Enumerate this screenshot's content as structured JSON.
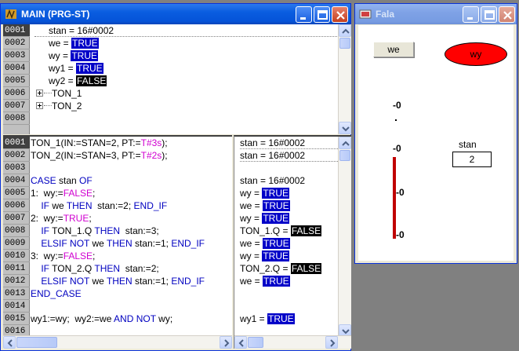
{
  "main_window": {
    "title": "MAIN (PRG-ST)",
    "declaration": {
      "line_numbers": [
        "0001",
        "0002",
        "0003",
        "0004",
        "0005",
        "0006",
        "0007",
        "0008"
      ],
      "lines": [
        {
          "name": "stan = 16#0002",
          "eq": "",
          "value": "",
          "type": "text"
        },
        {
          "name": "we = ",
          "value": "TRUE",
          "type": "true"
        },
        {
          "name": "wy = ",
          "value": "TRUE",
          "type": "true"
        },
        {
          "name": "wy1 = ",
          "value": "TRUE",
          "type": "true"
        },
        {
          "name": "wy2 = ",
          "value": "FALSE",
          "type": "false"
        }
      ],
      "tree": [
        "TON_1",
        "TON_2"
      ]
    },
    "code": {
      "line_numbers": [
        "0001",
        "0002",
        "0003",
        "0004",
        "0005",
        "0006",
        "0007",
        "0008",
        "0009",
        "0010",
        "0011",
        "0012",
        "0013",
        "0014",
        "0015",
        "0016"
      ],
      "lines": [
        [
          {
            "t": "TON_1(IN:=STAN=2, PT:="
          },
          {
            "t": "T#3s",
            "c": "tm"
          },
          {
            "t": ");"
          }
        ],
        [
          {
            "t": "TON_2(IN:=STAN=3, PT:="
          },
          {
            "t": "T#2s",
            "c": "tm"
          },
          {
            "t": ");"
          }
        ],
        [],
        [
          {
            "t": "CASE",
            "c": "kw"
          },
          {
            "t": " stan "
          },
          {
            "t": "OF",
            "c": "kw"
          }
        ],
        [
          {
            "t": "1:  wy:="
          },
          {
            "t": "FALSE",
            "c": "tm"
          },
          {
            "t": ";"
          }
        ],
        [
          {
            "t": "    "
          },
          {
            "t": "IF",
            "c": "kw"
          },
          {
            "t": " we "
          },
          {
            "t": "THEN",
            "c": "kw"
          },
          {
            "t": "  stan:=2; "
          },
          {
            "t": "END_IF",
            "c": "kw"
          }
        ],
        [
          {
            "t": "2:  wy:="
          },
          {
            "t": "TRUE",
            "c": "tm"
          },
          {
            "t": ";"
          }
        ],
        [
          {
            "t": "    "
          },
          {
            "t": "IF",
            "c": "kw"
          },
          {
            "t": " TON_1.Q "
          },
          {
            "t": "THEN",
            "c": "kw"
          },
          {
            "t": "  stan:=3;"
          }
        ],
        [
          {
            "t": "    "
          },
          {
            "t": "ELSIF NOT",
            "c": "kw"
          },
          {
            "t": " we "
          },
          {
            "t": "THEN",
            "c": "kw"
          },
          {
            "t": " stan:=1; "
          },
          {
            "t": "END_IF",
            "c": "kw"
          }
        ],
        [
          {
            "t": "3:  wy:="
          },
          {
            "t": "FALSE",
            "c": "tm"
          },
          {
            "t": ";"
          }
        ],
        [
          {
            "t": "    "
          },
          {
            "t": "IF",
            "c": "kw"
          },
          {
            "t": " TON_2.Q "
          },
          {
            "t": "THEN",
            "c": "kw"
          },
          {
            "t": "  stan:=2;"
          }
        ],
        [
          {
            "t": "    "
          },
          {
            "t": "ELSIF NOT",
            "c": "kw"
          },
          {
            "t": " we "
          },
          {
            "t": "THEN",
            "c": "kw"
          },
          {
            "t": " stan:=1; "
          },
          {
            "t": "END_IF",
            "c": "kw"
          }
        ],
        [
          {
            "t": "END_CASE",
            "c": "kw"
          }
        ],
        [],
        [
          {
            "t": "wy1:=wy;  wy2:=we "
          },
          {
            "t": "AND NOT",
            "c": "kw"
          },
          {
            "t": " wy;"
          }
        ],
        []
      ]
    },
    "monitor": [
      [
        {
          "t": "stan = 16#0002"
        }
      ],
      [
        {
          "t": "stan = 16#0002"
        }
      ],
      [],
      [
        {
          "t": "stan = 16#0002"
        }
      ],
      [
        {
          "t": "wy = "
        },
        {
          "t": "TRUE",
          "c": "hv"
        }
      ],
      [
        {
          "t": "we = "
        },
        {
          "t": "TRUE",
          "c": "hv"
        }
      ],
      [
        {
          "t": "wy = "
        },
        {
          "t": "TRUE",
          "c": "hv"
        }
      ],
      [
        {
          "t": "TON_1.Q = "
        },
        {
          "t": "FALSE",
          "c": "hf"
        }
      ],
      [
        {
          "t": "we = "
        },
        {
          "t": "TRUE",
          "c": "hv"
        }
      ],
      [
        {
          "t": "wy = "
        },
        {
          "t": "TRUE",
          "c": "hv"
        }
      ],
      [
        {
          "t": "TON_2.Q = "
        },
        {
          "t": "FALSE",
          "c": "hf"
        }
      ],
      [
        {
          "t": "we = "
        },
        {
          "t": "TRUE",
          "c": "hv"
        }
      ],
      [],
      [],
      [
        {
          "t": "wy1 = "
        },
        {
          "t": "TRUE",
          "c": "hv"
        }
      ],
      []
    ]
  },
  "visu_window": {
    "title": "Fala",
    "button_label": "we",
    "lamp_label": "wy",
    "lamp_color": "#ff0000",
    "scale_labels": [
      "-0",
      "-0",
      "-0",
      "-0"
    ],
    "stan_label": "stan",
    "stan_value": "2",
    "bar_color": "#c00000"
  }
}
